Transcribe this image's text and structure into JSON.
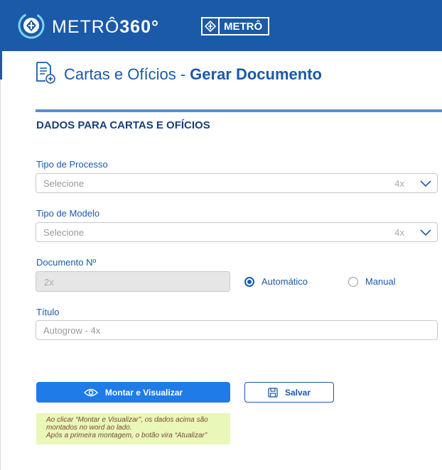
{
  "header": {
    "brand_prefix": "METRÔ",
    "brand_suffix": "360°",
    "badge_label": "METRÔ",
    "bar_color": "#1a5aa8"
  },
  "page": {
    "title_prefix": "Cartas e Ofícios - ",
    "title_bold": "Gerar Documento",
    "icon": "document-add-icon"
  },
  "section": {
    "title": "DADOS PARA CARTAS E OFÍCIOS"
  },
  "form": {
    "tipo_processo": {
      "label": "Tipo de Processo",
      "value": "Selecione",
      "hint": "4x"
    },
    "tipo_modelo": {
      "label": "Tipo de Modelo",
      "value": "Selecione",
      "hint": "4x"
    },
    "documento": {
      "label": "Documento Nº",
      "value": "2x",
      "options": [
        {
          "label": "Automático",
          "selected": true
        },
        {
          "label": "Manual",
          "selected": false
        }
      ]
    },
    "titulo": {
      "label": "Título",
      "placeholder": "Autogrow - 4x"
    }
  },
  "actions": {
    "primary_label": "Montar e Visualizar",
    "secondary_label": "Salvar",
    "primary_color": "#1e7be8"
  },
  "note": {
    "lines": [
      "Ao clicar “Montar e Visualizar”, os dados acima são",
      "montados no word ao lado.",
      "Após a primeira montagem, o botão vira “Atualizar”"
    ]
  }
}
